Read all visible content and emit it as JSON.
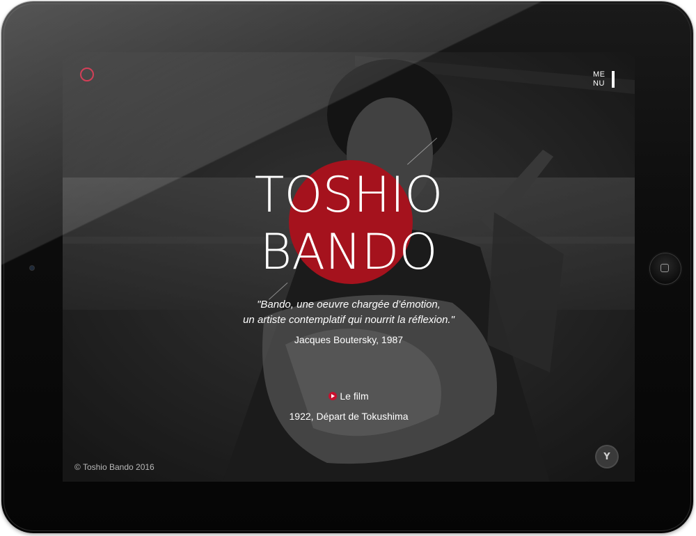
{
  "colors": {
    "accent": "#c8102e",
    "disc": "#a5121d",
    "text": "#ffffff",
    "bezel": "#0d0d0d"
  },
  "device": {
    "home_button_icon": "square-home-icon",
    "camera_icon": "camera-dot-icon"
  },
  "header": {
    "logo_icon": "circle-logo-icon",
    "menu_line1": "ME",
    "menu_line2": "NU",
    "menu_icon": "menu-bar-icon"
  },
  "hero": {
    "title_line1": "TOSHIO",
    "title_line2": "BANDO",
    "quote_line1": "\"Bando, une oeuvre chargée d’émotion,",
    "quote_line2": "un artiste contemplatif qui nourrit la réflexion.\"",
    "quote_author": "Jacques Boutersky, 1987"
  },
  "film": {
    "play_icon": "play-icon",
    "link_label": "Le film",
    "caption": "1922, Départ de Tokushima"
  },
  "footer": {
    "copyright": "© Toshio Bando 2016",
    "badge_label": "Y"
  }
}
